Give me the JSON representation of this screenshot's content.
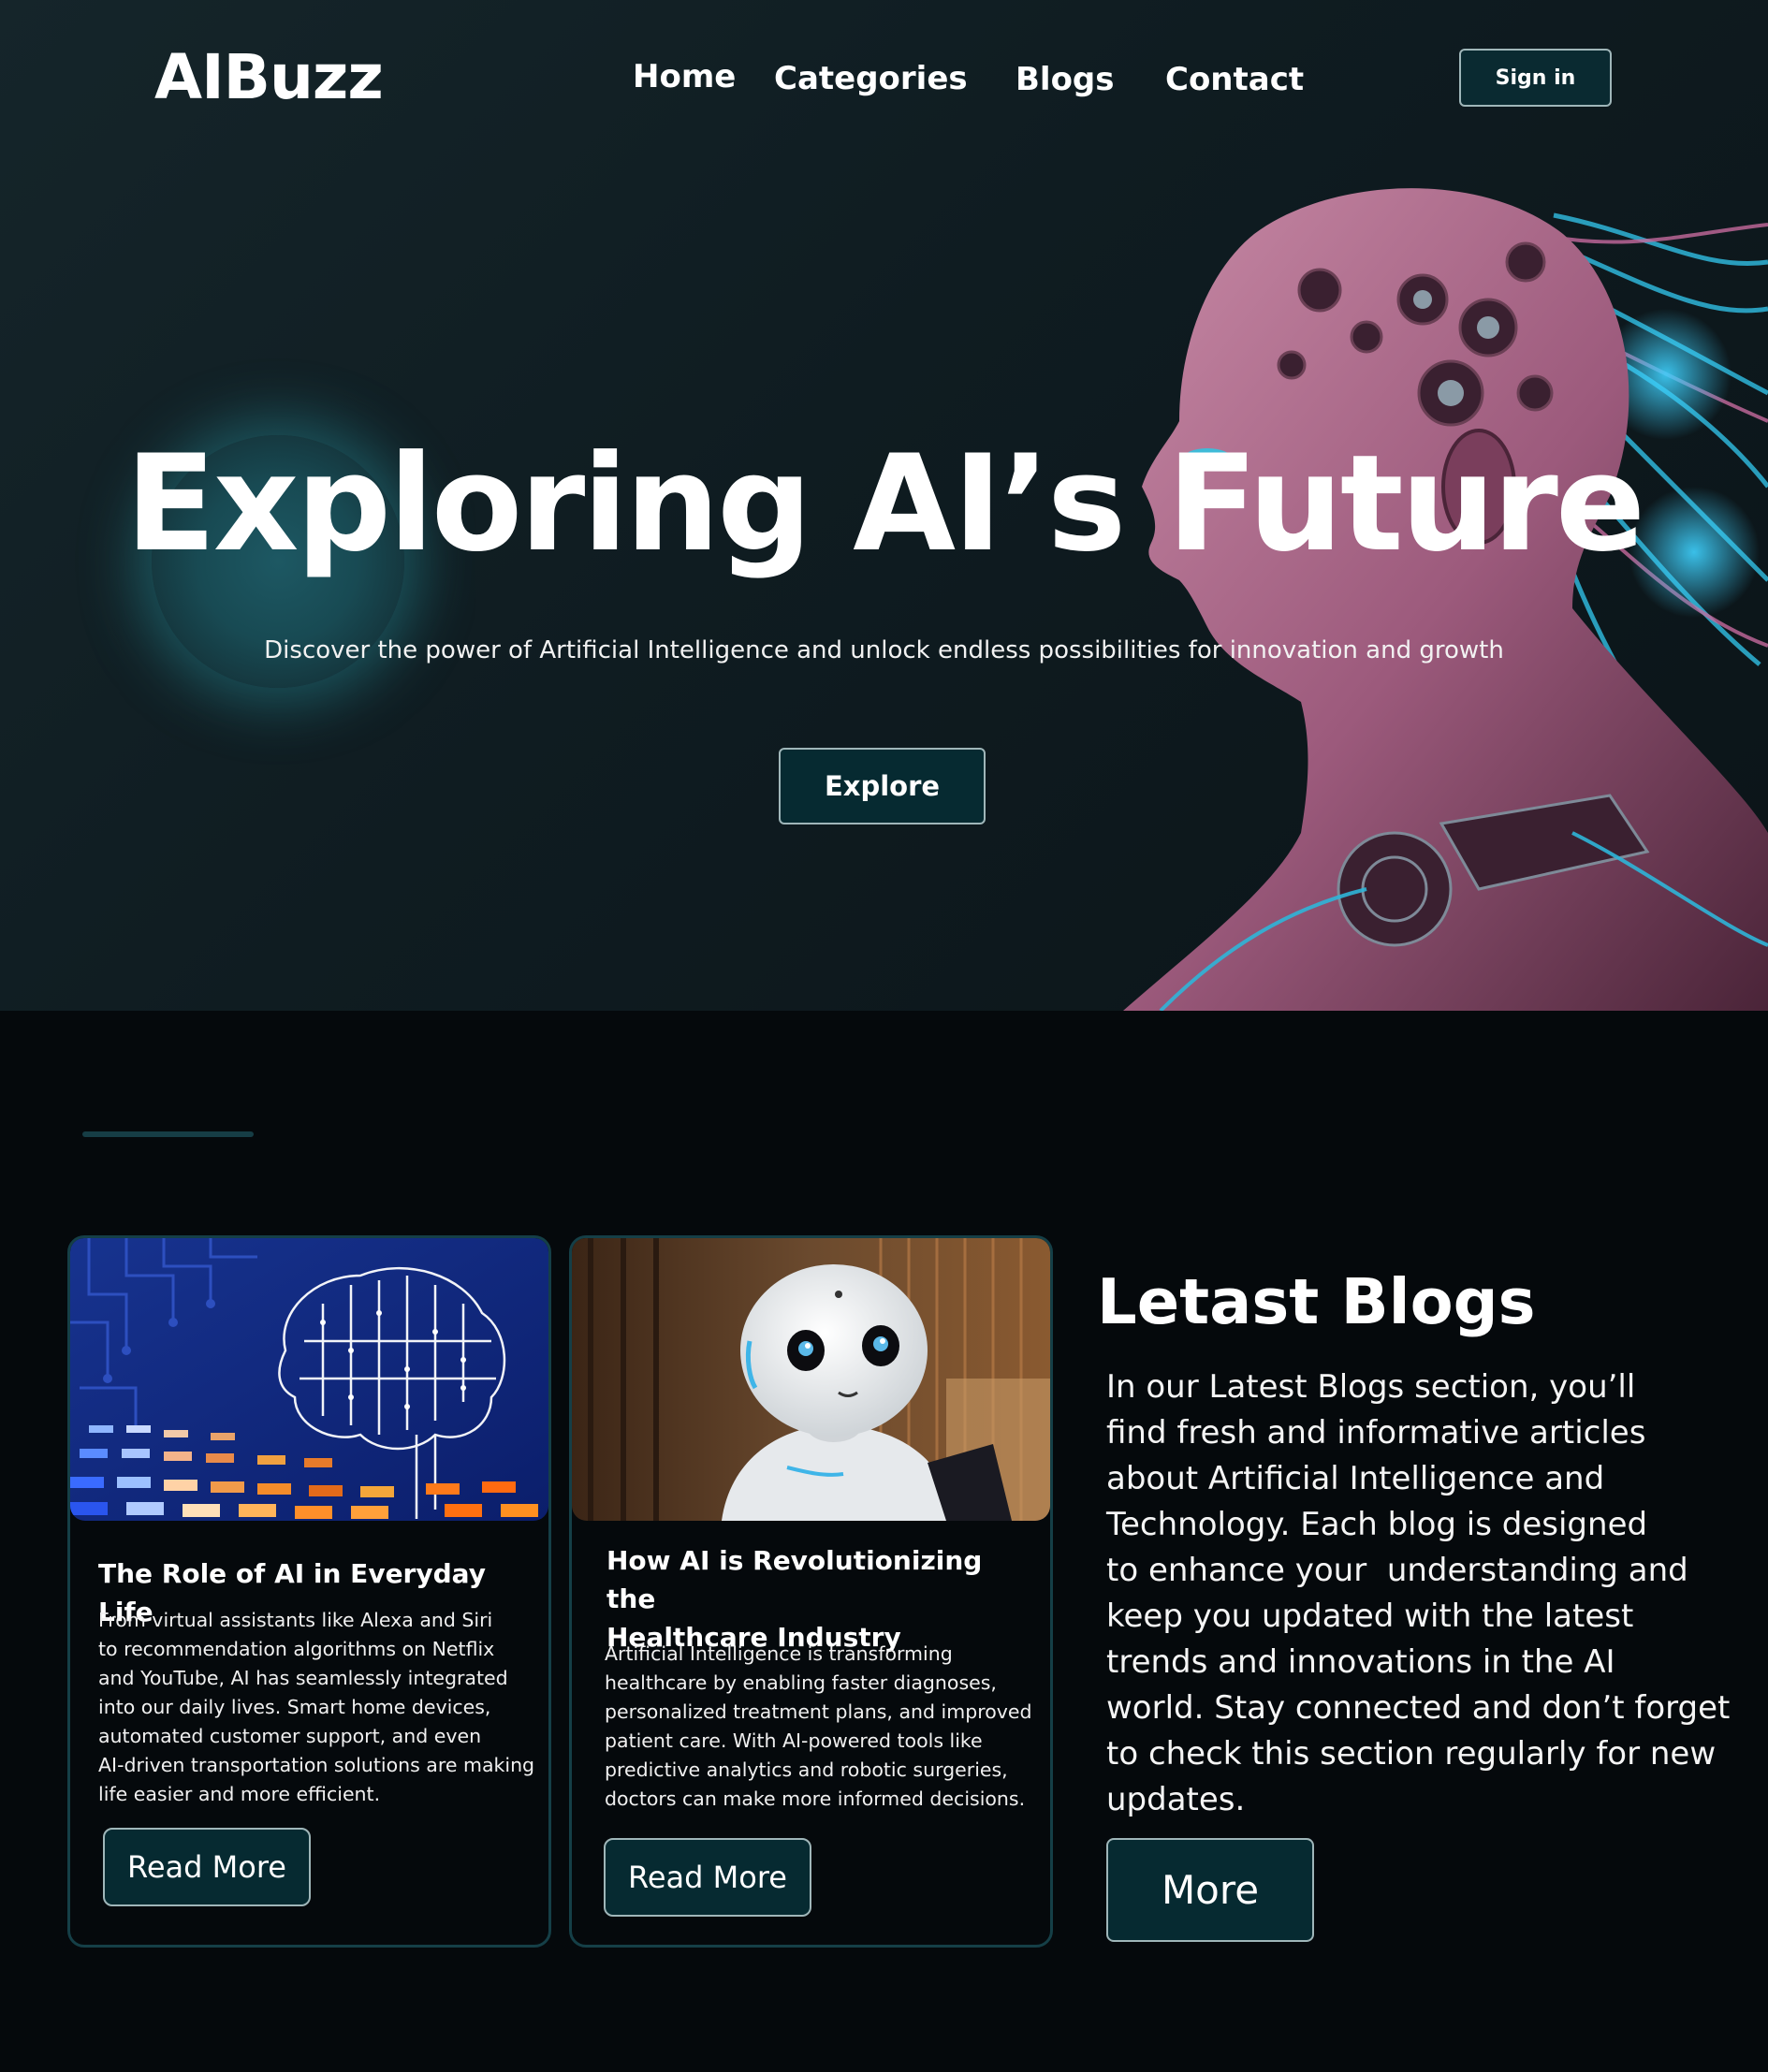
{
  "header": {
    "logo": "AIBuzz",
    "nav": [
      "Home",
      "Categories",
      "Blogs",
      "Contact"
    ],
    "signin_label": "Sign in"
  },
  "hero": {
    "title": "Exploring AI’s Future",
    "subtitle": "Discover the power of Artificial Intelligence and unlock endless possibilities for innovation and growth",
    "cta_label": "Explore",
    "image_subject": "robotic-woman-profile"
  },
  "blogs": {
    "cards": [
      {
        "image_subject": "circuit-brain",
        "title": "The Role of AI in Everyday Life",
        "body": [
          "From virtual assistants like Alexa and Siri",
          "to recommendation algorithms on Netflix",
          "and YouTube, AI has seamlessly integrated",
          "into our daily lives. Smart home devices,",
          "automated customer support, and even",
          "AI-driven transportation solutions are making",
          "life easier and more efficient."
        ],
        "button_label": "Read More"
      },
      {
        "image_subject": "humanoid-robot",
        "title_lines": [
          "How AI is Revolutionizing the",
          "Healthcare Industry"
        ],
        "body": [
          "Artificial Intelligence is transforming",
          "healthcare by enabling faster diagnoses,",
          "personalized treatment plans, and improved",
          "patient care. With AI-powered tools like",
          "predictive analytics and robotic surgeries,",
          "doctors can make more informed decisions."
        ],
        "button_label": "Read More"
      }
    ],
    "section_title": "Letast Blogs",
    "section_desc": [
      "In our Latest Blogs section, you’ll",
      "find fresh and informative articles",
      "about Artificial Intelligence and",
      "Technology. Each blog is designed",
      "to enhance your  understanding and",
      "keep you updated with the latest",
      "trends and innovations in the AI",
      "world. Stay connected and don’t forget",
      "to check this section regularly for new",
      "updates."
    ],
    "more_label": "More"
  },
  "colors": {
    "page_bg": "#05090c",
    "hero_bg": "#132227",
    "button_bg": "#062a31",
    "card_border": "#153f47",
    "accent_cyan": "#2fb5d8",
    "accent_pink": "#b0608c"
  }
}
